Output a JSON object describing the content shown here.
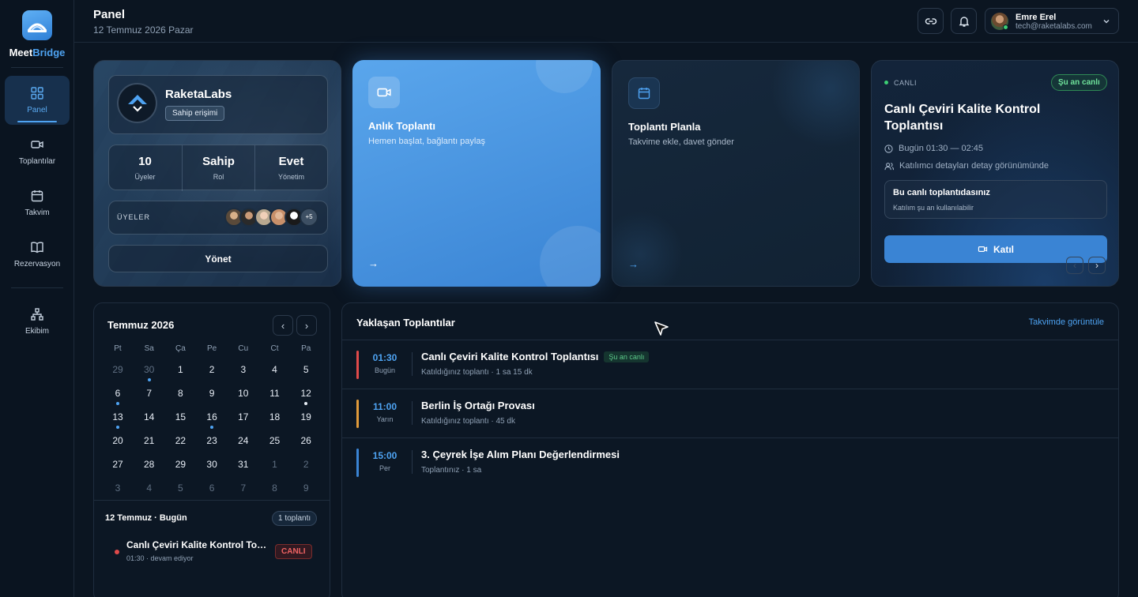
{
  "brand": {
    "part1": "Meet",
    "part2": "Bridge"
  },
  "sidebar": {
    "items": [
      {
        "label": "Panel",
        "icon": "grid-icon",
        "active": true
      },
      {
        "label": "Toplantılar",
        "icon": "video-icon"
      },
      {
        "label": "Takvim",
        "icon": "calendar-icon"
      },
      {
        "label": "Rezervasyon",
        "icon": "book-icon"
      },
      {
        "label": "Ekibim",
        "icon": "org-chart-icon"
      }
    ]
  },
  "header": {
    "title": "Panel",
    "date": "12 Temmuz 2026 Pazar"
  },
  "user": {
    "name": "Emre Erel",
    "email": "tech@raketalabs.com",
    "status_color": "#3ccf74"
  },
  "org": {
    "name": "RaketaLabs",
    "role_badge": "Sahip erişimi",
    "stats": [
      {
        "value": "10",
        "label": "Üyeler"
      },
      {
        "value": "Sahip",
        "label": "Rol"
      },
      {
        "value": "Evet",
        "label": "Yönetim"
      }
    ],
    "members_label": "ÜYELER",
    "members_more": "+5",
    "manage_label": "Yönet"
  },
  "instant": {
    "title": "Anlık Toplantı",
    "subtitle": "Hemen başlat, bağlantı paylaş",
    "arrow": "→"
  },
  "plan": {
    "title": "Toplantı Planla",
    "subtitle": "Takvime ekle, davet gönder",
    "arrow": "→"
  },
  "live": {
    "status_label": "CANLI",
    "badge": "Şu an canlı",
    "title": "Canlı Çeviri Kalite Kontrol Toplantısı",
    "time": "Bugün 01:30 — 02:45",
    "participants": "Katılımcı detayları detay görünümünde",
    "notice_title": "Bu canlı toplantıdasınız",
    "notice_sub": "Katılım şu an kullanılabilir",
    "join_label": "Katıl",
    "prev": "‹",
    "next": "›"
  },
  "calendar": {
    "title": "Temmuz 2026",
    "prev": "‹",
    "next": "›",
    "weekdays": [
      "Pt",
      "Sa",
      "Ça",
      "Pe",
      "Cu",
      "Ct",
      "Pa"
    ],
    "weeks": [
      [
        "29",
        "30",
        "1",
        "2",
        "3",
        "4",
        "5"
      ],
      [
        "6",
        "7",
        "8",
        "9",
        "10",
        "11",
        "12"
      ],
      [
        "13",
        "14",
        "15",
        "16",
        "17",
        "18",
        "19"
      ],
      [
        "20",
        "21",
        "22",
        "23",
        "24",
        "25",
        "26"
      ],
      [
        "27",
        "28",
        "29",
        "30",
        "31",
        "1",
        "2"
      ],
      [
        "3",
        "4",
        "5",
        "6",
        "7",
        "8",
        "9"
      ]
    ],
    "today_label": "12 Temmuz · Bugün",
    "count_badge": "1 toplantı",
    "event": {
      "title": "Canlı Çeviri Kalite Kontrol Toplantısı",
      "sub": "01:30 · devam ediyor",
      "badge": "CANLI"
    }
  },
  "upcoming": {
    "title": "Yaklaşan Toplantılar",
    "link": "Takvimde görüntüle",
    "rows": [
      {
        "time": "01:30",
        "day": "Bugün",
        "name": "Canlı Çeviri Kalite Kontrol Toplantısı",
        "badge": "Şu an canlı",
        "sub": "Katıldığınız toplantı · 1 sa 15 dk",
        "color": "#e04a4a"
      },
      {
        "time": "11:00",
        "day": "Yarın",
        "name": "Berlin İş Ortağı Provası",
        "badge": "",
        "sub": "Katıldığınız toplantı · 45 dk",
        "color": "#e09a3a"
      },
      {
        "time": "15:00",
        "day": "Per",
        "name": "3. Çeyrek İşe Alım Planı Değerlendirmesi",
        "badge": "",
        "sub": "Toplantınız · 1 sa",
        "color": "#3a84d4"
      }
    ]
  }
}
